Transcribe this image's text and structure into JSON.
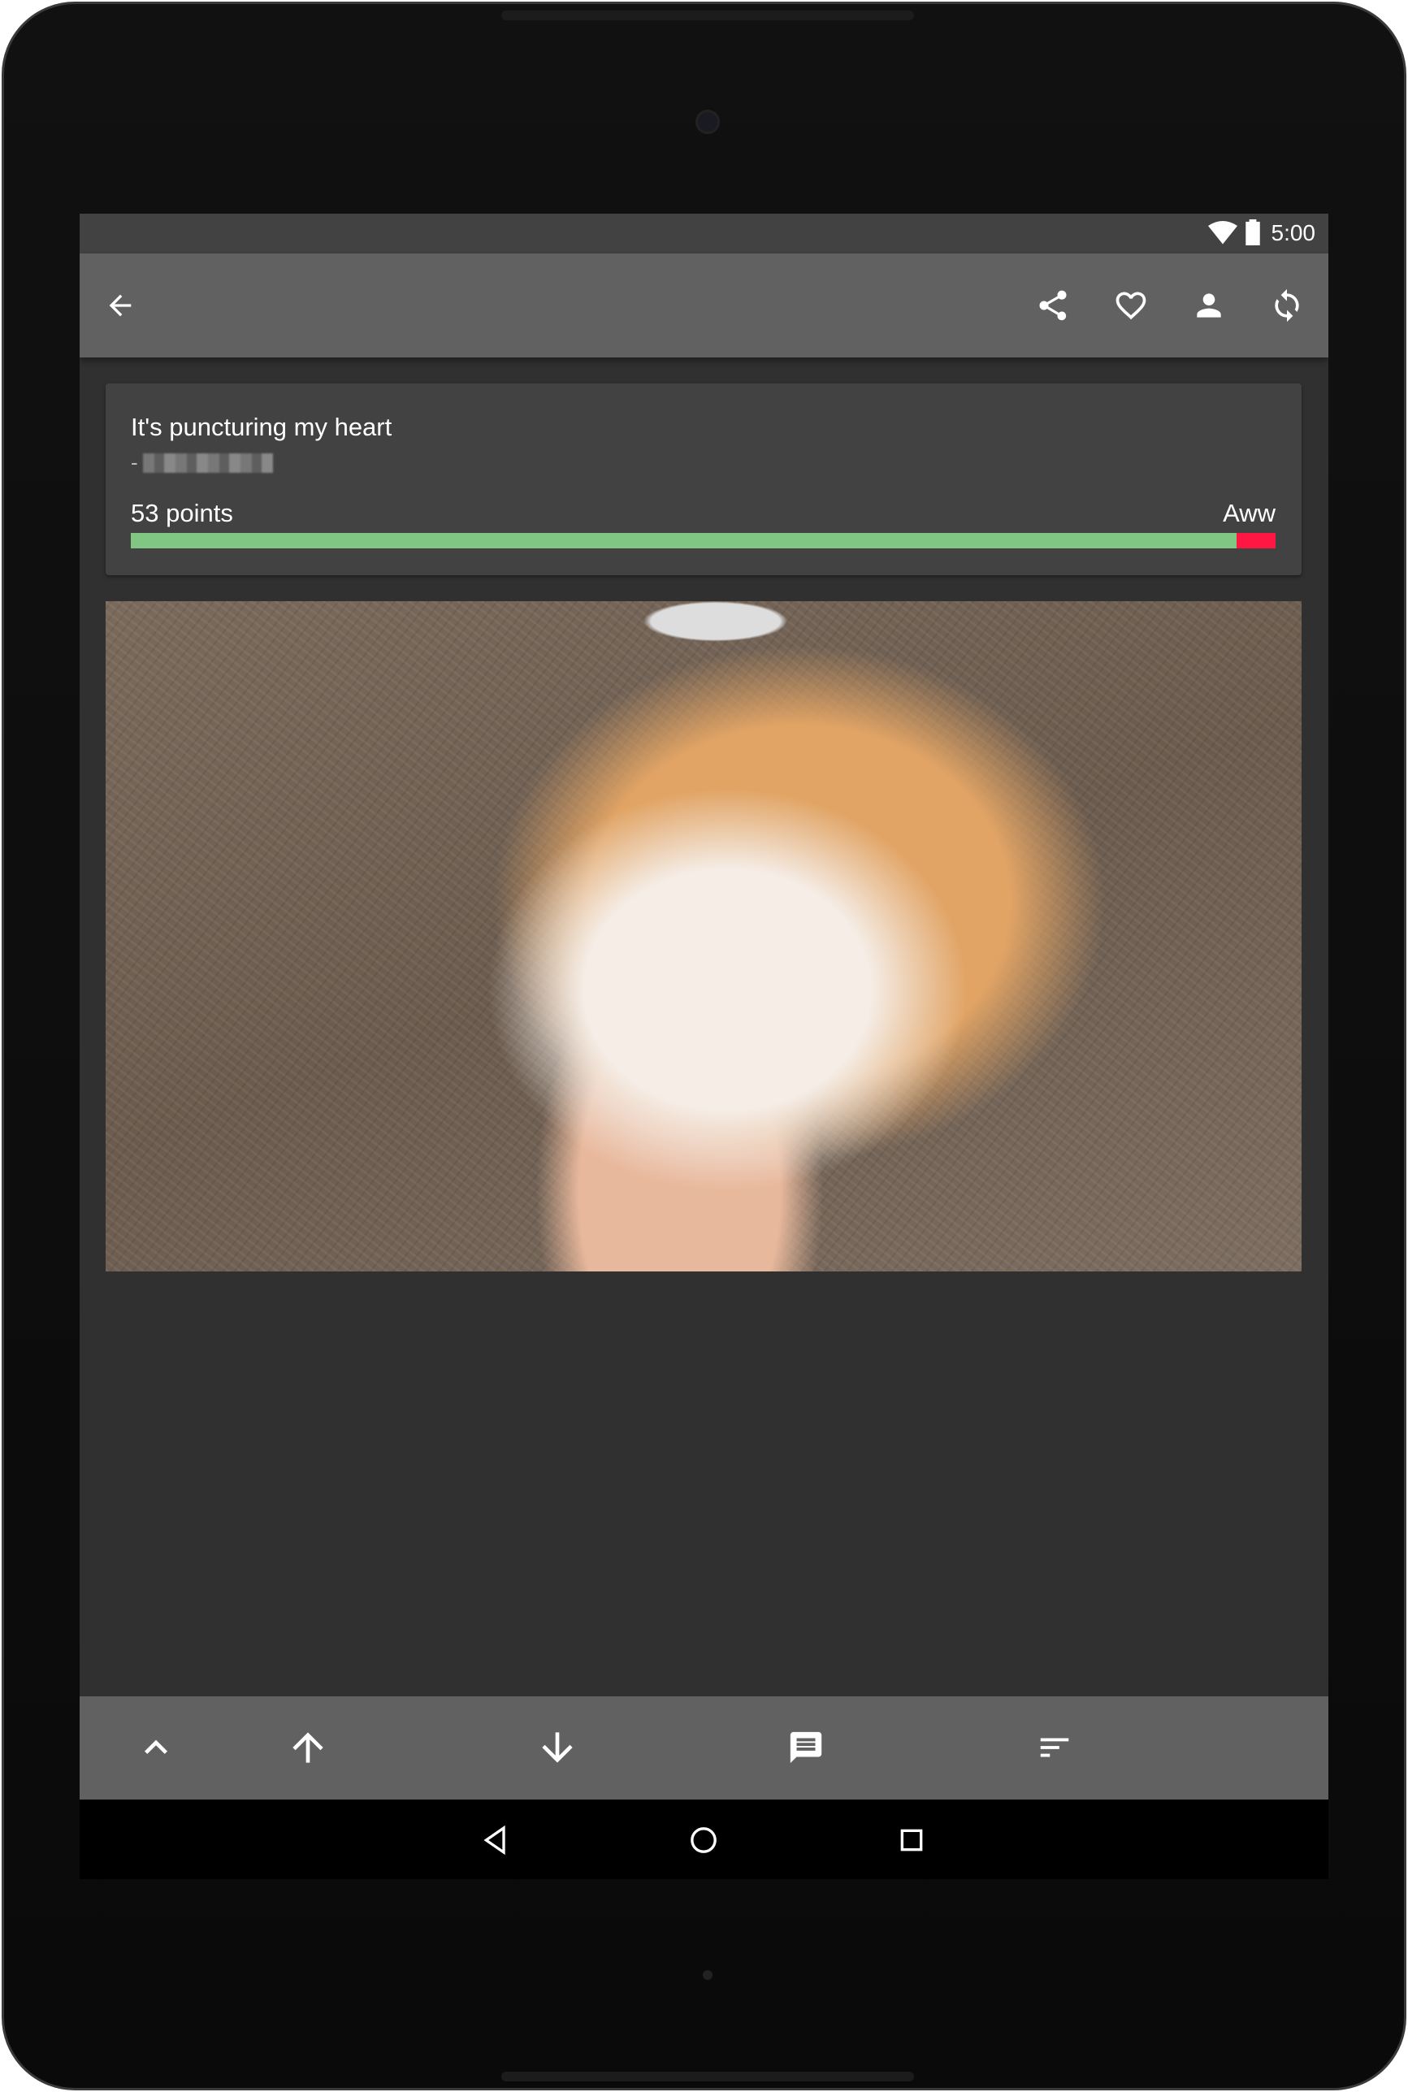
{
  "status_bar": {
    "time": "5:00",
    "icons": [
      "wifi-icon",
      "battery-icon"
    ]
  },
  "toolbar": {
    "back": "back-arrow-icon",
    "actions": [
      "share-icon",
      "heart-icon",
      "person-icon",
      "refresh-icon"
    ]
  },
  "post": {
    "title": "It's puncturing my heart",
    "author_prefix": "-",
    "points": "53 points",
    "subreddit": "Aww",
    "upvote_ratio": 0.966,
    "colors": {
      "upvote": "#81c784",
      "downvote": "#ff1744"
    }
  },
  "bottom_bar": {
    "actions": [
      "chevron-up-icon",
      "upvote-arrow-icon",
      "downvote-arrow-icon",
      "comments-icon",
      "sort-icon"
    ]
  },
  "nav_bar": {
    "actions": [
      "back-triangle-icon",
      "home-circle-icon",
      "recents-square-icon"
    ]
  }
}
